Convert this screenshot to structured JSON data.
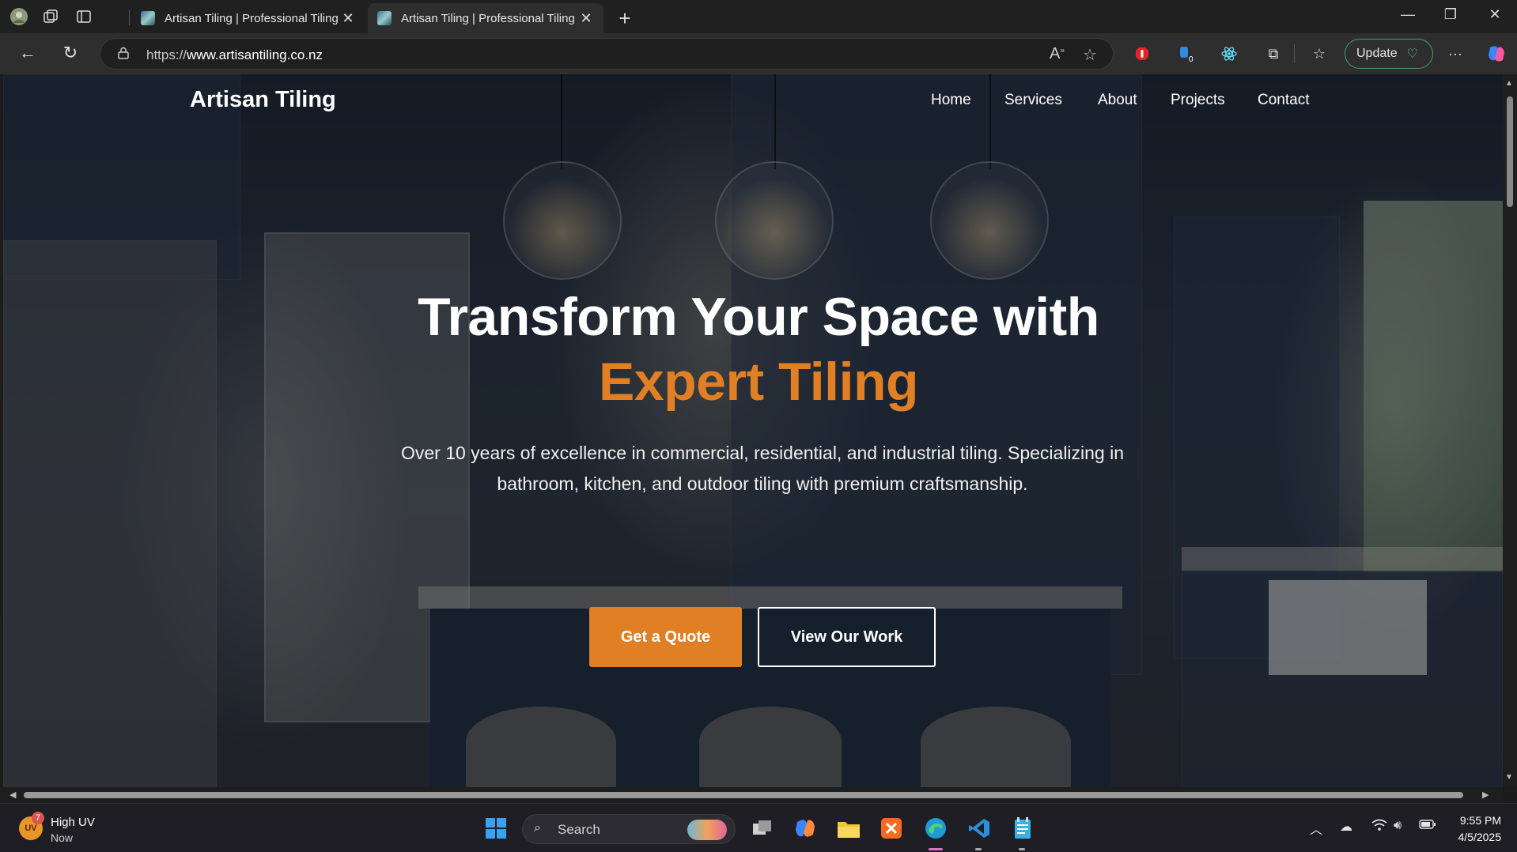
{
  "browser": {
    "tabs": [
      {
        "title": "Artisan Tiling | Professional Tiling",
        "active": false
      },
      {
        "title": "Artisan Tiling | Professional Tiling",
        "active": true
      }
    ],
    "new_tab_icon": "plus-icon",
    "url_prefix": "https://",
    "url_host": "www.artisantiling.co.nz",
    "update_label": "Update",
    "extension_badge": "0"
  },
  "site": {
    "logo": "Artisan Tiling",
    "nav": [
      "Home",
      "Services",
      "About",
      "Projects",
      "Contact"
    ],
    "hero": {
      "title_line1": "Transform Your Space with",
      "title_line2": "Expert Tiling",
      "subtitle": "Over 10 years of excellence in commercial, residential, and industrial tiling. Specializing in bathroom, kitchen, and outdoor tiling with premium craftsmanship.",
      "primary_cta": "Get a Quote",
      "secondary_cta": "View Our Work"
    },
    "colors": {
      "accent": "#e07f24",
      "text": "#ffffff"
    }
  },
  "taskbar": {
    "weather_title": "High UV",
    "weather_sub": "Now",
    "weather_icon_text": "UV",
    "weather_badge": "7",
    "search_placeholder": "Search",
    "time": "9:55 PM",
    "date": "4/5/2025"
  }
}
